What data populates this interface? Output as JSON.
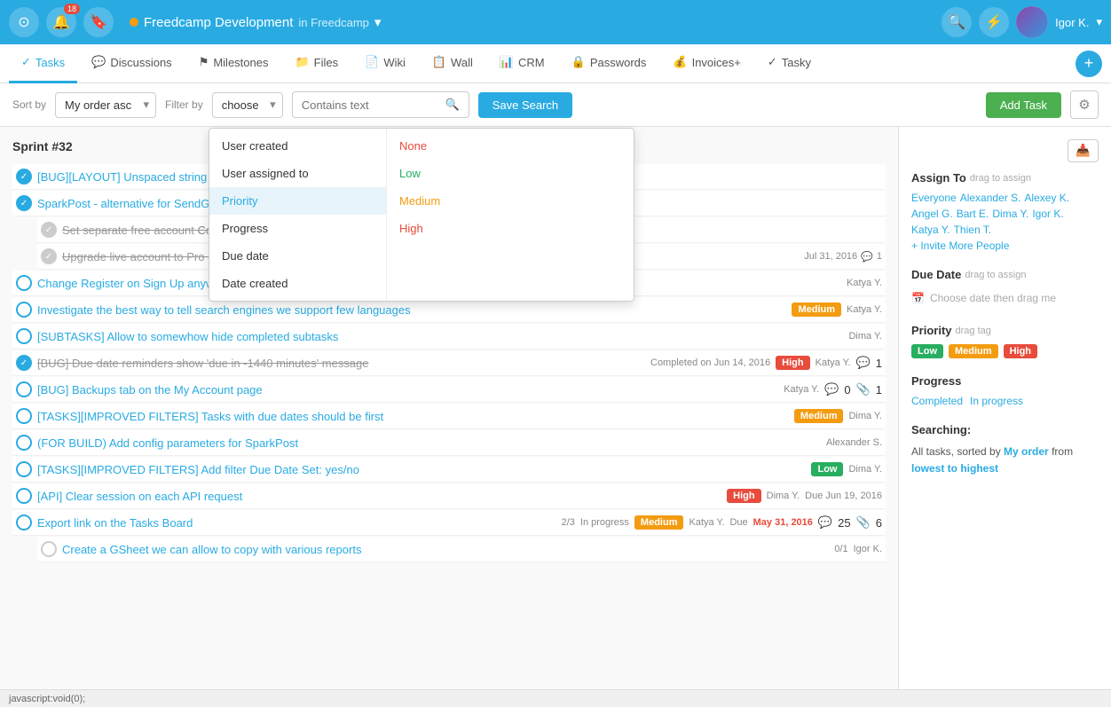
{
  "topNav": {
    "notificationCount": "18",
    "projectName": "Freedcamp Development",
    "inText": "in Freedcamp",
    "userName": "Igor K.",
    "searchIcon": "🔍",
    "bellIcon": "🔔",
    "bookmarkIcon": "🔖",
    "lightningIcon": "⚡"
  },
  "tabs": [
    {
      "id": "tasks",
      "label": "Tasks",
      "icon": "✓",
      "active": true
    },
    {
      "id": "discussions",
      "label": "Discussions",
      "icon": "💬",
      "active": false
    },
    {
      "id": "milestones",
      "label": "Milestones",
      "icon": "⚑",
      "active": false
    },
    {
      "id": "files",
      "label": "Files",
      "icon": "📁",
      "active": false
    },
    {
      "id": "wiki",
      "label": "Wiki",
      "icon": "📄",
      "active": false
    },
    {
      "id": "wall",
      "label": "Wall",
      "icon": "📋",
      "active": false
    },
    {
      "id": "crm",
      "label": "CRM",
      "icon": "📊",
      "active": false
    },
    {
      "id": "passwords",
      "label": "Passwords",
      "icon": "🔒",
      "active": false
    },
    {
      "id": "invoices",
      "label": "Invoices+",
      "icon": "💰",
      "active": false
    },
    {
      "id": "tasky",
      "label": "Tasky",
      "icon": "✓",
      "active": false
    }
  ],
  "toolbar": {
    "sortLabel": "Sort by",
    "sortValue": "My order asc",
    "filterLabel": "Filter by",
    "filterValue": "choose",
    "searchPlaceholder": "Contains text",
    "saveSearchLabel": "Save Search",
    "addTaskLabel": "Add Task"
  },
  "filterDropdown": {
    "leftItems": [
      {
        "label": "User created",
        "active": false
      },
      {
        "label": "User assigned to",
        "active": false
      },
      {
        "label": "Priority",
        "active": true
      },
      {
        "label": "Progress",
        "active": false
      },
      {
        "label": "Due date",
        "active": false
      },
      {
        "label": "Date created",
        "active": false
      }
    ],
    "rightItems": [
      {
        "label": "None",
        "color": "#e74c3c"
      },
      {
        "label": "Low",
        "color": "#27ae60"
      },
      {
        "label": "Medium",
        "color": "#f39c12"
      },
      {
        "label": "High",
        "color": "#e74c3c"
      }
    ]
  },
  "sprint": {
    "label": "Sprint #32"
  },
  "tasks": [
    {
      "id": 1,
      "done": true,
      "text": "[BUG][LAYOUT] Unspaced string bre...",
      "strikethrough": false,
      "user": "",
      "priority": "",
      "date": ""
    },
    {
      "id": 2,
      "done": true,
      "text": "SparkPost - alternative for SendGrid",
      "strikethrough": false,
      "user": "",
      "priority": "",
      "date": ""
    },
    {
      "id": 3,
      "done": true,
      "sub": true,
      "text": "Set separate free account",
      "suffix": "Con...",
      "strikethrough": true,
      "user": "",
      "priority": "",
      "date": ""
    },
    {
      "id": 4,
      "done": true,
      "sub": true,
      "text": "Upgrade live account to Pro -...",
      "strikethrough": true,
      "user": "",
      "priority": "",
      "date": "Jul 31, 2016",
      "comments": "1"
    },
    {
      "id": 5,
      "done": false,
      "text": "Change Register on Sign Up anywhere on the public pages",
      "user": "Katya Y.",
      "priority": "",
      "date": ""
    },
    {
      "id": 6,
      "done": false,
      "text": "Investigate the best way to tell search engines we support few languages",
      "user": "Katya Y.",
      "priority": "Medium",
      "date": ""
    },
    {
      "id": 7,
      "done": false,
      "text": "[SUBTASKS] Allow to somewhow hide completed subtasks",
      "user": "Dima Y.",
      "priority": "",
      "date": ""
    },
    {
      "id": 8,
      "done": true,
      "strikethrough": true,
      "text": "[BUG] Due date reminders show 'due in -1440 minutes' message",
      "completedText": "Completed on Jun 14, 2016",
      "user": "Katya Y.",
      "priority": "High",
      "date": "",
      "comments": "1"
    },
    {
      "id": 9,
      "done": false,
      "text": "[BUG] Backups tab on the My Account page",
      "user": "Katya Y.",
      "priority": "",
      "date": "",
      "comments": "0",
      "files": "1"
    },
    {
      "id": 10,
      "done": false,
      "text": "[TASKS][IMPROVED FILTERS] Tasks with due dates should be first",
      "user": "Dima Y.",
      "priority": "Medium",
      "date": ""
    },
    {
      "id": 11,
      "done": false,
      "text": "(FOR BUILD) Add config parameters for SparkPost",
      "user": "Alexander S.",
      "priority": "",
      "date": ""
    },
    {
      "id": 12,
      "done": false,
      "text": "[TASKS][IMPROVED FILTERS] Add filter Due Date Set: yes/no",
      "user": "Dima Y.",
      "priority": "Low",
      "date": ""
    },
    {
      "id": 13,
      "done": false,
      "text": "[API] Clear session on each API request",
      "user": "Dima Y.",
      "priority": "High",
      "date": "Due Jun 19, 2016"
    },
    {
      "id": 14,
      "done": false,
      "text": "Export link on the Tasks Board",
      "subCount": "2/3",
      "progress": "In progress",
      "user": "Katya Y.",
      "priority": "Medium",
      "dueLabel": "Due",
      "date": "May 31, 2016",
      "dateOverdue": true,
      "comments": "25",
      "files": "6"
    },
    {
      "id": 15,
      "done": false,
      "sub": true,
      "text": "Create a GSheet we can allow to copy with various reports",
      "subCount": "0/1",
      "user": "Igor K.",
      "priority": "",
      "date": ""
    }
  ],
  "rightPanel": {
    "assignTitle": "Assign To",
    "assignHint": "drag to assign",
    "people": [
      "Everyone",
      "Alexander S.",
      "Alexey K.",
      "Angel G.",
      "Bart E.",
      "Dima Y.",
      "Igor K.",
      "Katya Y.",
      "Thien T."
    ],
    "inviteMore": "+ Invite More People",
    "dueDateTitle": "Due Date",
    "dueDateHint": "drag to assign",
    "dueDatePlaceholder": "Choose date then drag me",
    "priorityTitle": "Priority",
    "priorityHint": "drag tag",
    "priorityTags": [
      {
        "label": "Low",
        "class": "badge-low"
      },
      {
        "label": "Medium",
        "class": "badge-medium"
      },
      {
        "label": "High",
        "class": "badge-high"
      }
    ],
    "progressTitle": "Progress",
    "progressItems": [
      "Completed",
      "In progress"
    ],
    "searchingTitle": "Searching:",
    "searchingText": "All tasks, sorted by My order from lowest to highest"
  },
  "statusBar": {
    "text": "javascript:void(0);"
  }
}
